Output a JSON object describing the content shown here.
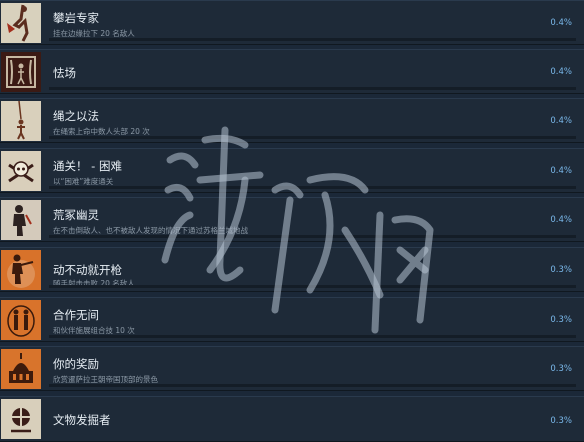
{
  "achievements": [
    {
      "title": "攀岩专家",
      "desc": "挂在边缘拉下 20 名敌人",
      "percent": "0.4%",
      "icon": "climber-icon",
      "bg": "#d8d1bd",
      "fg": "#5a2c1e"
    },
    {
      "title": "怯场",
      "desc": "",
      "percent": "0.4%",
      "icon": "stage-fright-icon",
      "bg": "#3b1a14",
      "fg": "#c7b8a2"
    },
    {
      "title": "绳之以法",
      "desc": "在绳索上命中数人头部 20 次",
      "percent": "0.4%",
      "icon": "rope-icon",
      "bg": "#d9d0bc",
      "fg": "#6a3520"
    },
    {
      "title": "通关！ - 困难",
      "desc": "以“困难”难度通关",
      "percent": "0.4%",
      "icon": "skull-icon",
      "bg": "#d9cfbb",
      "fg": "#3a1d18"
    },
    {
      "title": "荒冢幽灵",
      "desc": "在不击倒敌人、也不被敌人发现的情况下通过苏格兰城地战",
      "percent": "0.4%",
      "icon": "ghost-soldier-icon",
      "bg": "#d4cabb",
      "fg": "#2d2221"
    },
    {
      "title": "动不动就开枪",
      "desc": "随手射击击败 20 名敌人",
      "percent": "0.3%",
      "icon": "shooter-icon",
      "bg": "#d8722a",
      "fg": "#3a1a0c"
    },
    {
      "title": "合作无间",
      "desc": "和伙伴施展组合技 10 次",
      "percent": "0.3%",
      "icon": "teamwork-icon",
      "bg": "#d9732b",
      "fg": "#3a1a0c"
    },
    {
      "title": "你的奖励",
      "desc": "欣赏暹萨拉王朝帝国顶部的景色",
      "percent": "0.3%",
      "icon": "palace-icon",
      "bg": "#d8742c",
      "fg": "#3d1b0c"
    },
    {
      "title": "文物发掘者",
      "desc": "",
      "percent": "0.3%",
      "icon": "relic-icon",
      "bg": "#d8cfbb",
      "fg": "#3a1d18"
    }
  ],
  "watermark": "游侠网"
}
